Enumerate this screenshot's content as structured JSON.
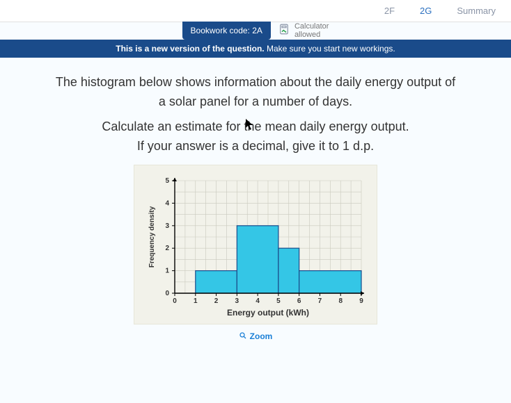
{
  "topbar": {
    "tab_prev": "2F",
    "tab_current": "2G",
    "tab_summary": "Summary"
  },
  "badge": {
    "bookwork_label": "Bookwork code:",
    "bookwork_code": "2A",
    "calc_line1": "Calculator",
    "calc_line2": "allowed"
  },
  "banner": {
    "bold": "This is a new version of the question.",
    "rest": " Make sure you start new workings."
  },
  "question": {
    "line1": "The histogram below shows information about the daily energy output of",
    "line2": "a solar panel for a number of days.",
    "line3": "Calculate an estimate for the mean daily energy output.",
    "line4": "If your answer is a decimal, give it to 1 d.p."
  },
  "chart_data": {
    "type": "bar",
    "title": "",
    "xlabel": "Energy output (kWh)",
    "ylabel": "Frequency density",
    "x_ticks": [
      0,
      1,
      2,
      3,
      4,
      5,
      6,
      7,
      8,
      9
    ],
    "y_ticks": [
      0,
      1,
      2,
      3,
      4,
      5
    ],
    "xlim": [
      0,
      9
    ],
    "ylim": [
      0,
      5
    ],
    "bars": [
      {
        "x_start": 1,
        "x_end": 3,
        "height": 1
      },
      {
        "x_start": 3,
        "x_end": 5,
        "height": 3
      },
      {
        "x_start": 5,
        "x_end": 6,
        "height": 2
      },
      {
        "x_start": 6,
        "x_end": 9,
        "height": 1
      }
    ]
  },
  "zoom_label": "Zoom"
}
